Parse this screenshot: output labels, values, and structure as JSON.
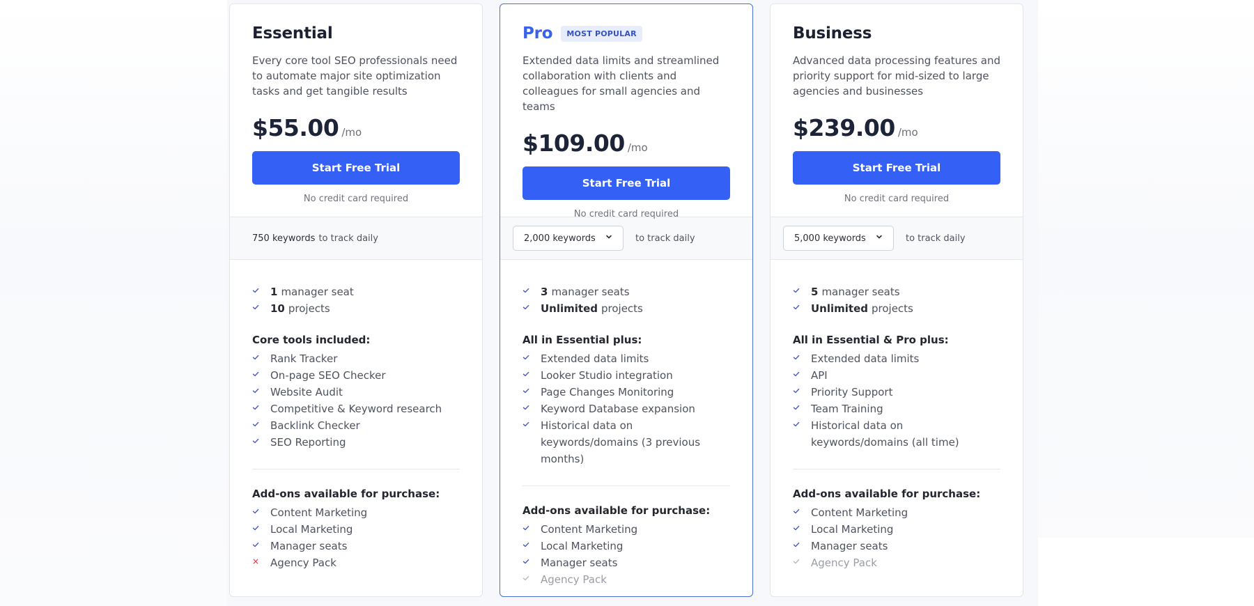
{
  "colors": {
    "accent": "#3560f5",
    "popular_border": "#4a6fd6",
    "check": "#4a5bc4",
    "cross": "#e5474f",
    "muted_check": "#b7b9c2"
  },
  "plans": [
    {
      "name": "Essential",
      "badge": null,
      "description": "Every core tool SEO professionals need to automate major site optimization tasks and get tangible results",
      "price": "$55.00",
      "period": "/mo",
      "cta": "Start Free Trial",
      "note": "No credit card required",
      "keywords": {
        "value": "750 keywords",
        "suffix": "to track daily",
        "selectable": false
      },
      "basics": [
        {
          "strong": "1",
          "text": "manager seat"
        },
        {
          "strong": "10",
          "text": "projects"
        }
      ],
      "features_title": "Core tools included:",
      "features": [
        "Rank Tracker",
        "On-page SEO Checker",
        "Website Audit",
        "Competitive & Keyword research",
        "Backlink Checker",
        "SEO Reporting"
      ],
      "addons_title": "Add-ons available for purchase:",
      "addons": [
        {
          "label": "Content Marketing",
          "status": "included"
        },
        {
          "label": "Local Marketing",
          "status": "included"
        },
        {
          "label": "Manager seats",
          "status": "included"
        },
        {
          "label": "Agency Pack",
          "status": "unavailable"
        }
      ]
    },
    {
      "name": "Pro",
      "badge": "MOST POPULAR",
      "description": "Extended data limits and streamlined collaboration with clients and colleagues for small agencies and teams",
      "price": "$109.00",
      "period": "/mo",
      "cta": "Start Free Trial",
      "note": "No credit card required",
      "keywords": {
        "value": "2,000 keywords",
        "suffix": "to track daily",
        "selectable": true
      },
      "basics": [
        {
          "strong": "3",
          "text": "manager seats"
        },
        {
          "strong": "Unlimited",
          "text": "projects"
        }
      ],
      "features_title": "All in Essential plus:",
      "features": [
        "Extended data limits",
        "Looker Studio integration",
        "Page Changes Monitoring",
        "Keyword Database expansion",
        "Historical data on keywords/domains (3 previous months)"
      ],
      "addons_title": "Add-ons available for purchase:",
      "addons": [
        {
          "label": "Content Marketing",
          "status": "included"
        },
        {
          "label": "Local Marketing",
          "status": "included"
        },
        {
          "label": "Manager seats",
          "status": "included"
        },
        {
          "label": "Agency Pack",
          "status": "muted"
        }
      ]
    },
    {
      "name": "Business",
      "badge": null,
      "description": "Advanced data processing features and priority support for mid-sized to large agencies and businesses",
      "price": "$239.00",
      "period": "/mo",
      "cta": "Start Free Trial",
      "note": "No credit card required",
      "keywords": {
        "value": "5,000 keywords",
        "suffix": "to track daily",
        "selectable": true
      },
      "basics": [
        {
          "strong": "5",
          "text": "manager seats"
        },
        {
          "strong": "Unlimited",
          "text": "projects"
        }
      ],
      "features_title": "All in Essential & Pro plus:",
      "features": [
        "Extended data limits",
        "API",
        "Priority Support",
        "Team Training",
        "Historical data on keywords/domains (all time)"
      ],
      "addons_title": "Add-ons available for purchase:",
      "addons": [
        {
          "label": "Content Marketing",
          "status": "included"
        },
        {
          "label": "Local Marketing",
          "status": "included"
        },
        {
          "label": "Manager seats",
          "status": "included"
        },
        {
          "label": "Agency Pack",
          "status": "muted"
        }
      ]
    }
  ]
}
